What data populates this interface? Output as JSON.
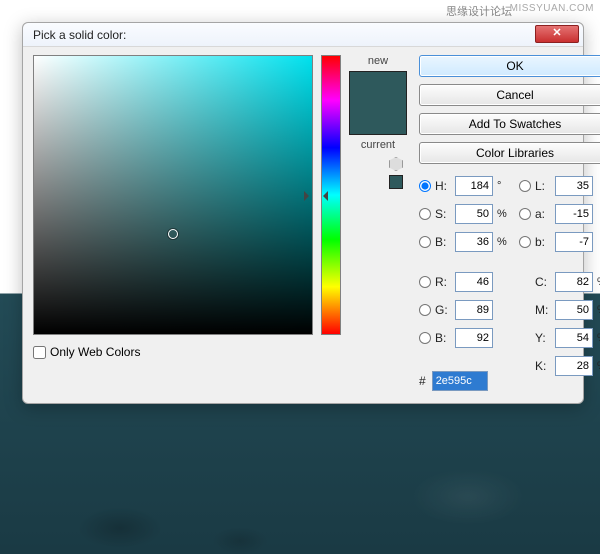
{
  "watermark_cn": "思缘设计论坛",
  "watermark_en": ".MISSYUAN.COM",
  "title": "Pick a solid color:",
  "close_glyph": "✕",
  "web_only_label": "Only Web Colors",
  "swatch": {
    "new_label": "new",
    "current_label": "current",
    "new_color": "#2e595c",
    "current_color": "#2e595c"
  },
  "buttons": {
    "ok": "OK",
    "cancel": "Cancel",
    "add": "Add To Swatches",
    "lib": "Color Libraries"
  },
  "hsv": {
    "H": {
      "label": "H:",
      "value": "184",
      "unit": "°"
    },
    "S": {
      "label": "S:",
      "value": "50",
      "unit": "%"
    },
    "B": {
      "label": "B:",
      "value": "36",
      "unit": "%"
    }
  },
  "rgb": {
    "R": {
      "label": "R:",
      "value": "46"
    },
    "G": {
      "label": "G:",
      "value": "89"
    },
    "B": {
      "label": "B:",
      "value": "92"
    }
  },
  "lab": {
    "L": {
      "label": "L:",
      "value": "35"
    },
    "a": {
      "label": "a:",
      "value": "-15"
    },
    "b": {
      "label": "b:",
      "value": "-7"
    }
  },
  "cmyk": {
    "C": {
      "label": "C:",
      "value": "82",
      "unit": "%"
    },
    "M": {
      "label": "M:",
      "value": "50",
      "unit": "%"
    },
    "Y": {
      "label": "Y:",
      "value": "54",
      "unit": "%"
    },
    "K": {
      "label": "K:",
      "value": "28",
      "unit": "%"
    }
  },
  "hex": {
    "label": "#",
    "value": "2e595c"
  }
}
